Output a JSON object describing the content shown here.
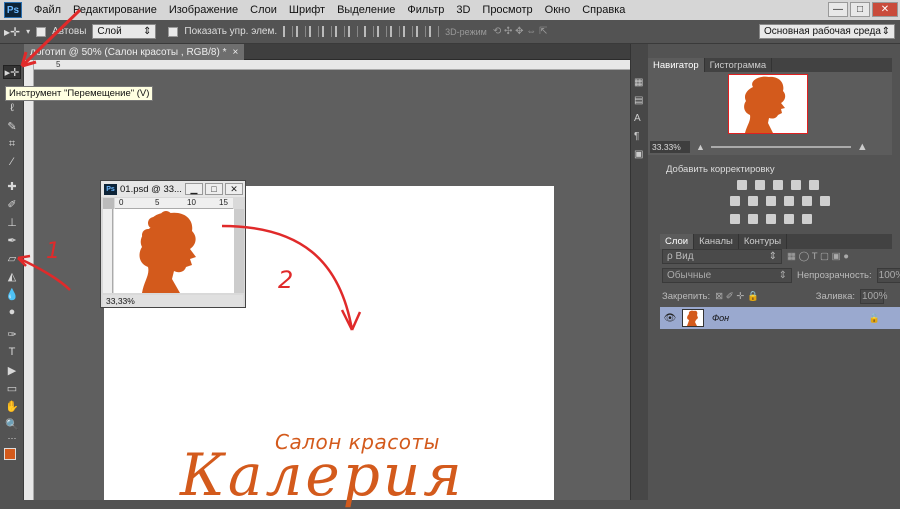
{
  "menu": {
    "items": [
      "Файл",
      "Редактирование",
      "Изображение",
      "Слои",
      "Шрифт",
      "Выделение",
      "Фильтр",
      "3D",
      "Просмотр",
      "Окно",
      "Справка"
    ],
    "minimize": "—",
    "maximize": "□",
    "close": "✕"
  },
  "options": {
    "auto_select_label": "Автовы",
    "layer_select": "Слой",
    "show_controls_label": "Показать упр. элем.",
    "mode_3d": "3D-режим",
    "workspace": "Основная рабочая среда"
  },
  "doc_tab": {
    "title": "логотип @ 50% (Салон красоты , RGB/8) *",
    "close": "×"
  },
  "ruler_top_label": "5",
  "tooltip": "Инструмент \"Перемещение\" (V)",
  "canvas": {
    "subtitle": "Салон красоты",
    "title": "Калерия"
  },
  "subwindow": {
    "title": "01.psd @ 33...",
    "ruler": [
      "0",
      "5",
      "10",
      "15"
    ],
    "zoom": "33,33%"
  },
  "annotations": {
    "one": "1",
    "two": "2"
  },
  "navigator": {
    "tabs": [
      "Навигатор",
      "Гистограмма"
    ],
    "zoom": "33.33%"
  },
  "adjustments": {
    "title": "Добавить корректировку"
  },
  "layers": {
    "tabs": [
      "Слои",
      "Каналы",
      "Контуры"
    ],
    "kind": "ρ Вид",
    "blend": "Обычные",
    "opacity_label": "Непрозрачность:",
    "opacity": "100%",
    "lock_label": "Закрепить:",
    "fill_label": "Заливка:",
    "fill": "100%",
    "layer_name": "Фон"
  },
  "colors": {
    "accent": "#d35a1c",
    "arrow": "#e02a2a"
  }
}
